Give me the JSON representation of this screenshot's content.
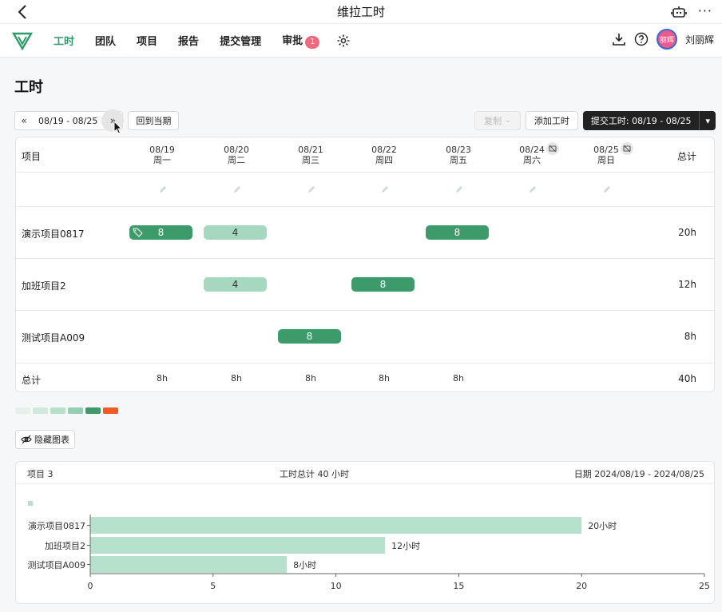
{
  "app": {
    "title": "维拉工时",
    "more": "···"
  },
  "nav": {
    "items": [
      {
        "label": "工时",
        "active": true
      },
      {
        "label": "团队"
      },
      {
        "label": "项目"
      },
      {
        "label": "报告"
      },
      {
        "label": "提交管理"
      },
      {
        "label": "审批",
        "badge": "1"
      }
    ],
    "user": {
      "name": "刘丽辉",
      "avatar_text": "丽辉"
    }
  },
  "page": {
    "title": "工时"
  },
  "toolbar": {
    "range": "08/19 - 08/25",
    "today_label": "回到当期",
    "copy_label": "复制",
    "add_label": "添加工时",
    "submit_label": "提交工时: 08/19 - 08/25"
  },
  "table": {
    "header_project": "项目",
    "header_total": "总计",
    "days": [
      {
        "date": "08/19",
        "weekday": "周一"
      },
      {
        "date": "08/20",
        "weekday": "周二"
      },
      {
        "date": "08/21",
        "weekday": "周三"
      },
      {
        "date": "08/22",
        "weekday": "周四"
      },
      {
        "date": "08/23",
        "weekday": "周五"
      },
      {
        "date": "08/24",
        "weekday": "周六"
      },
      {
        "date": "08/25",
        "weekday": "周日"
      }
    ],
    "rows": [
      {
        "name": "演示项目0817",
        "total": "20h"
      },
      {
        "name": "加班项目2",
        "total": "12h"
      },
      {
        "name": "测试项目A009",
        "total": "8h"
      }
    ],
    "entries": [
      {
        "row": 0,
        "day": 0,
        "value": "8",
        "style": "dark",
        "tag": true
      },
      {
        "row": 0,
        "day": 1,
        "value": "4",
        "style": "light"
      },
      {
        "row": 0,
        "day": 4,
        "value": "8",
        "style": "dark"
      },
      {
        "row": 1,
        "day": 1,
        "value": "4",
        "style": "light"
      },
      {
        "row": 1,
        "day": 3,
        "value": "8",
        "style": "dark"
      },
      {
        "row": 2,
        "day": 2,
        "value": "8",
        "style": "dark"
      }
    ],
    "footer_label": "总计",
    "footer_days": [
      "8h",
      "8h",
      "8h",
      "8h",
      "8h",
      "",
      ""
    ],
    "footer_total": "40h"
  },
  "legend_colors": [
    "#e6f1ec",
    "#d1e9dd",
    "#b8dfcc",
    "#93cfb2",
    "#3d9a6b",
    "#ef5b25"
  ],
  "hide_chart_label": "隐藏图表",
  "summary": {
    "projects": "项目 3",
    "total": "工时总计 40 小时",
    "dates": "日期 2024/08/19 - 2024/08/25"
  },
  "chart_data": {
    "type": "bar",
    "orientation": "horizontal",
    "categories": [
      "演示项目0817",
      "加班项目2",
      "测试项目A009"
    ],
    "values": [
      20,
      12,
      8
    ],
    "value_labels": [
      "20小时",
      "12小时",
      "8小时"
    ],
    "xlim": [
      0,
      25
    ],
    "xticks": [
      0,
      5,
      10,
      15,
      20,
      25
    ],
    "bar_color": "#b6e2cd",
    "legend": "top-left"
  }
}
